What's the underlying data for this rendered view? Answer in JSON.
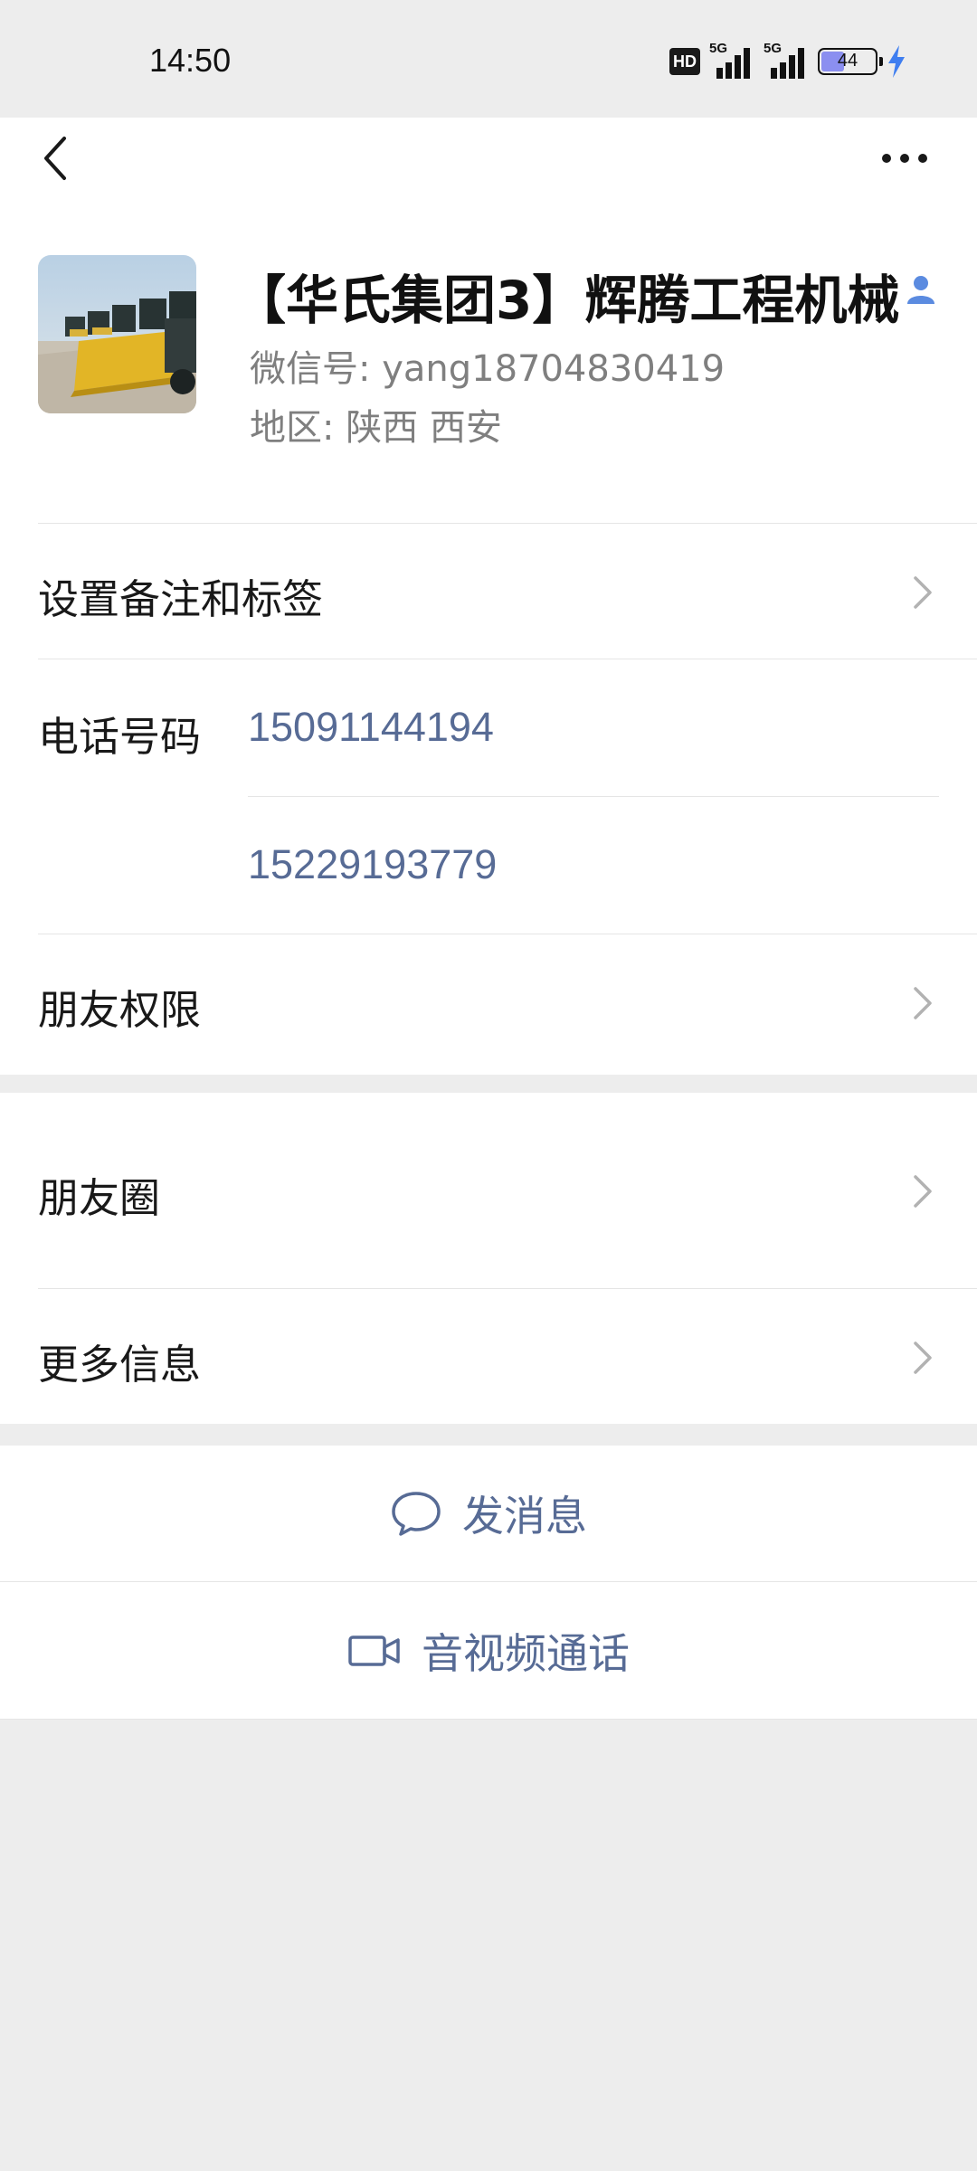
{
  "status_bar": {
    "time": "14:50",
    "hd_label": "HD",
    "signal1_label": "5G",
    "signal2_label": "5G",
    "battery_level": "44",
    "charging_icon": "lightning-bolt-icon"
  },
  "nav": {
    "back_icon": "chevron-left-icon",
    "more_icon": "more-dots-icon"
  },
  "profile": {
    "name": "【华氏集团3】辉腾工程机械",
    "wechat_id": "微信号: yang18704830419",
    "region": "地区: 陕西  西安",
    "contact_icon": "person-icon",
    "avatar_alt": "wheel-loader-photo"
  },
  "settings": {
    "remark_label": "设置备注和标签",
    "phone_label": "电话号码",
    "phones": [
      "15091144194",
      "15229193779"
    ],
    "friend_permissions_label": "朋友权限"
  },
  "more_section": {
    "moments_label": "朋友圈",
    "more_info_label": "更多信息"
  },
  "actions": {
    "message_label": "发消息",
    "call_label": "音视频通话"
  },
  "colors": {
    "background": "#ededed",
    "link_blue": "#576b95",
    "contact_icon_blue": "#5b8be0"
  }
}
